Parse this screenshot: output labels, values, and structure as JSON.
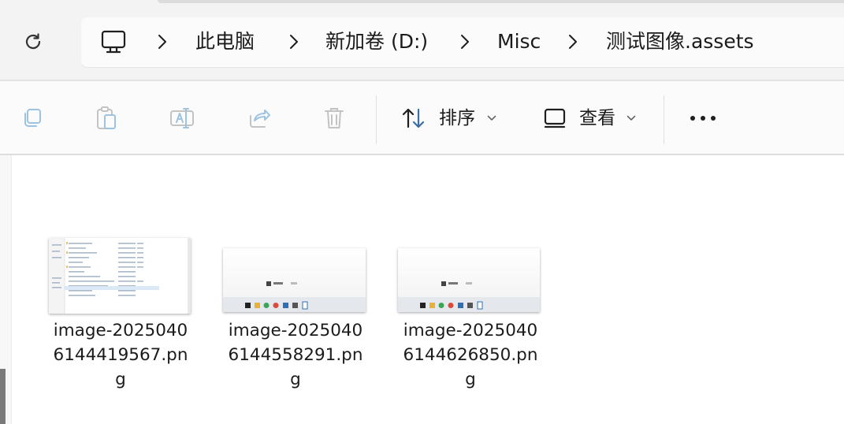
{
  "address_bar": {
    "breadcrumbs": [
      "此电脑",
      "新加卷 (D:)",
      "Misc",
      "测试图像.assets"
    ],
    "icons": {
      "refresh": "refresh-icon",
      "root": "computer-icon",
      "separator": "chevron-right-icon"
    }
  },
  "toolbar": {
    "sort_label": "排序",
    "view_label": "查看",
    "icons": [
      "copy-icon",
      "paste-icon",
      "rename-icon",
      "share-icon",
      "delete-icon",
      "sort-icon",
      "view-icon",
      "more-icon"
    ],
    "more_glyph": "•••",
    "disabled_color": "#9ec3e0"
  },
  "files": [
    {
      "name": "image-20250406144419567.png",
      "line1": "image-2025040",
      "line2": "6144419567.pn",
      "line3": "g"
    },
    {
      "name": "image-20250406144558291.png",
      "line1": "image-2025040",
      "line2": "6144558291.pn",
      "line3": "g"
    },
    {
      "name": "image-20250406144626850.png",
      "line1": "image-2025040",
      "line2": "6144626850.pn",
      "line3": "g"
    }
  ]
}
